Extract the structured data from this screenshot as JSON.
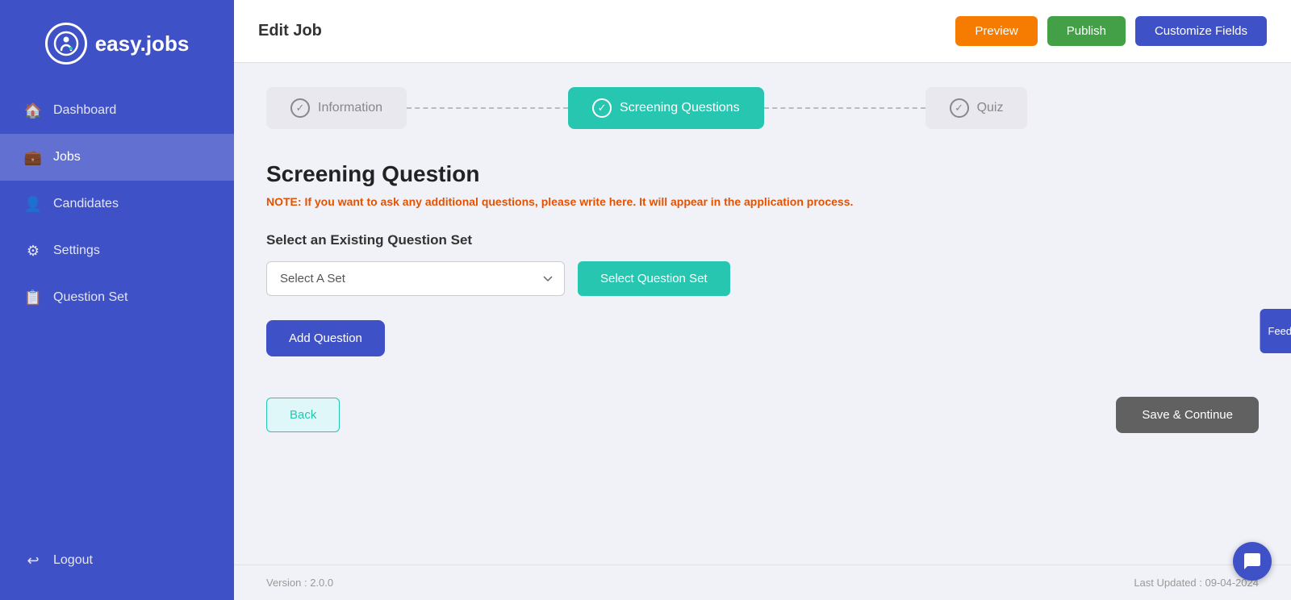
{
  "sidebar": {
    "logo_text": "easy.jobs",
    "items": [
      {
        "id": "dashboard",
        "label": "Dashboard",
        "icon": "🏠",
        "active": false
      },
      {
        "id": "jobs",
        "label": "Jobs",
        "icon": "💼",
        "active": true
      },
      {
        "id": "candidates",
        "label": "Candidates",
        "icon": "👤",
        "active": false
      },
      {
        "id": "settings",
        "label": "Settings",
        "icon": "⚙",
        "active": false
      },
      {
        "id": "question-set",
        "label": "Question Set",
        "icon": "📋",
        "active": false
      }
    ],
    "logout_label": "Logout",
    "logout_icon": "↩"
  },
  "topbar": {
    "title": "Edit Job",
    "preview_label": "Preview",
    "publish_label": "Publish",
    "customize_label": "Customize Fields"
  },
  "steps": [
    {
      "id": "information",
      "label": "Information",
      "active": false
    },
    {
      "id": "screening-questions",
      "label": "Screening Questions",
      "active": true
    },
    {
      "id": "quiz",
      "label": "Quiz",
      "active": false
    }
  ],
  "page": {
    "title": "Screening Question",
    "note_label": "NOTE:",
    "note_text": "If you want to ask any additional questions, please write here. It will appear in the application process.",
    "question_set_label": "Select an Existing Question Set",
    "select_placeholder": "Select A Set",
    "select_question_set_btn": "Select Question Set",
    "add_question_btn": "Add Question",
    "back_btn": "Back",
    "save_continue_btn": "Save & Continue"
  },
  "footer": {
    "version": "Version : 2.0.0",
    "last_updated": "Last Updated : 09-04-2024"
  },
  "feedback_label": "Feedback"
}
